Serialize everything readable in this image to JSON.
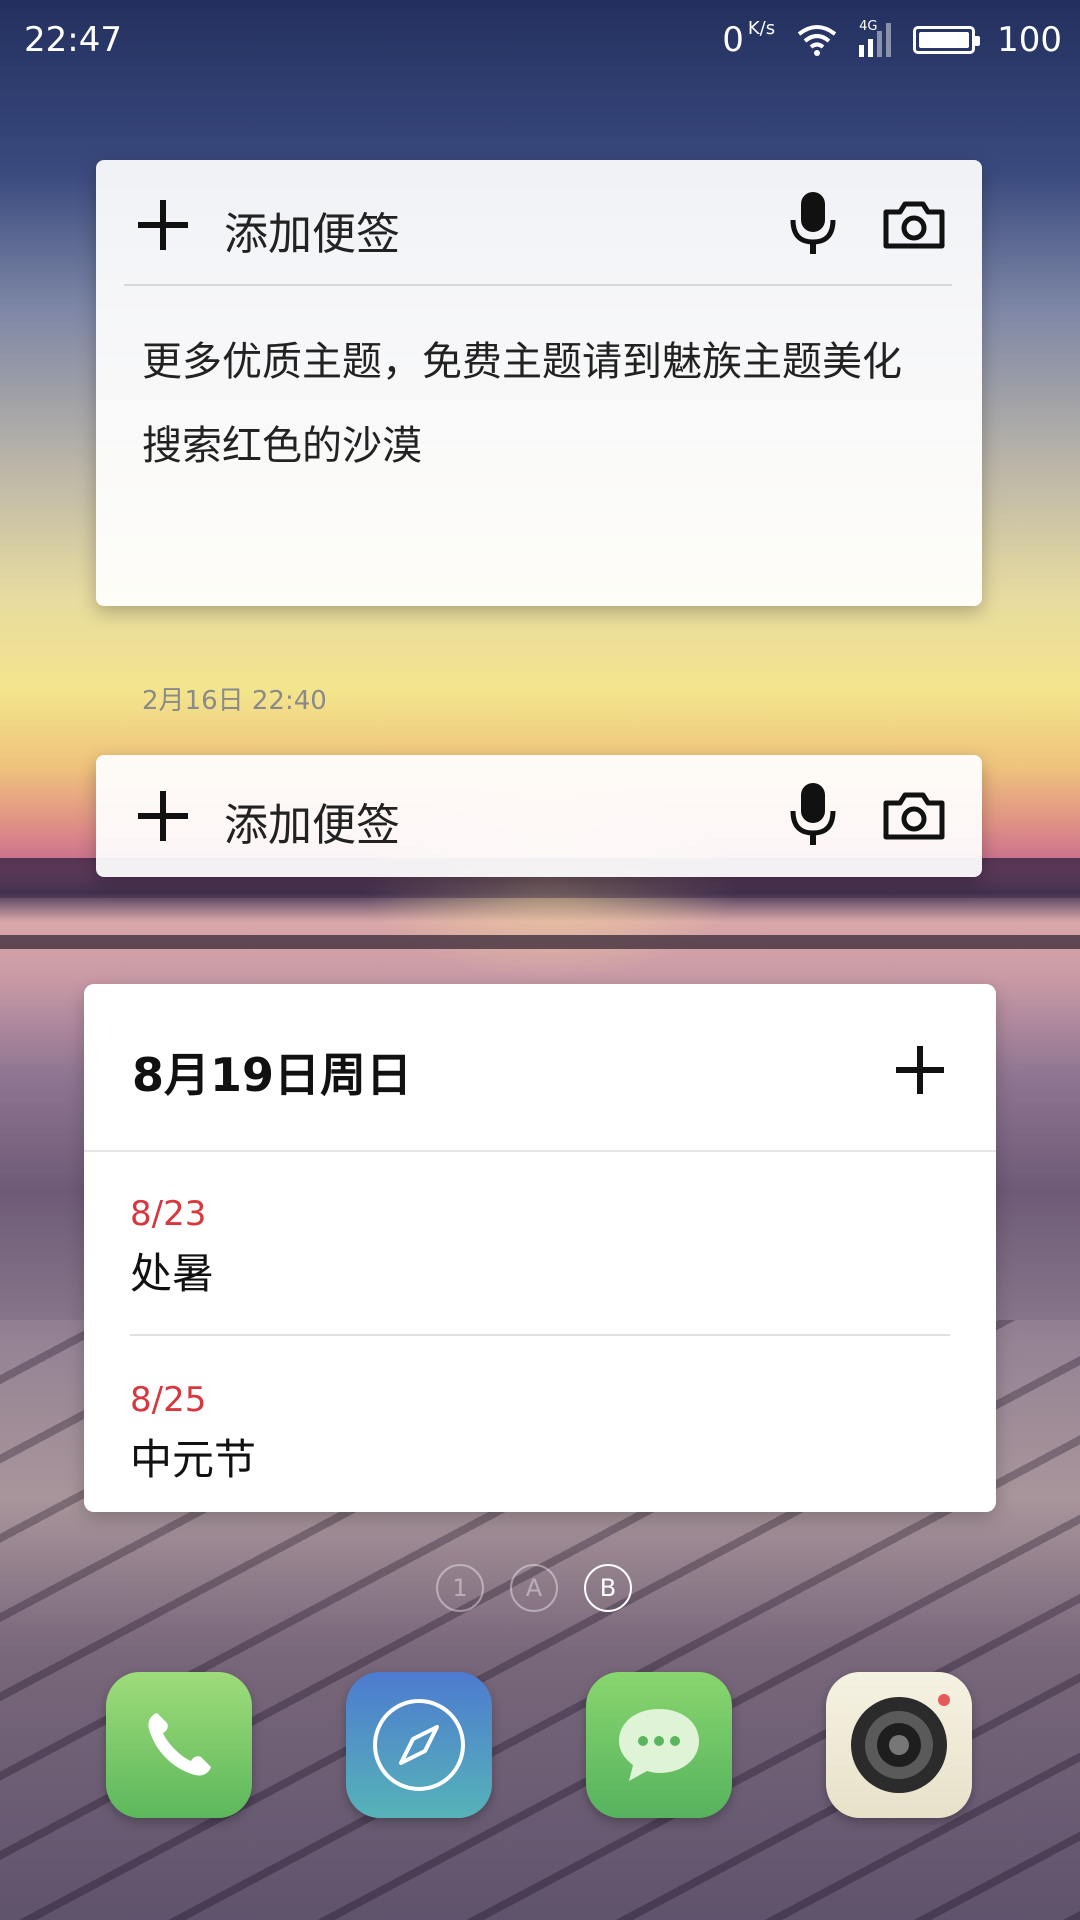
{
  "status_bar": {
    "time": "22:47",
    "net_speed_value": "0",
    "net_speed_unit": "K/s",
    "network_type": "4G",
    "battery_level": "100"
  },
  "note_widget_1": {
    "add_label": "添加便签",
    "note_text": "更多优质主题，免费主题请到魅族主题美化搜索红色的沙漠",
    "note_date": "2月16日  22:40"
  },
  "note_widget_2": {
    "add_label": "添加便签"
  },
  "calendar_widget": {
    "header": "8月19日周日",
    "events": [
      {
        "date": "8/23",
        "name": "处暑"
      },
      {
        "date": "8/25",
        "name": "中元节"
      }
    ]
  },
  "page_indicators": [
    "1",
    "A",
    "B"
  ],
  "dock": {
    "apps": [
      "phone-icon",
      "browser-icon",
      "messages-icon",
      "camera-icon"
    ]
  },
  "colors": {
    "event_date": "#d9363e",
    "phone_app": "#5cb85c",
    "browser_app": "#4d7bd0"
  }
}
